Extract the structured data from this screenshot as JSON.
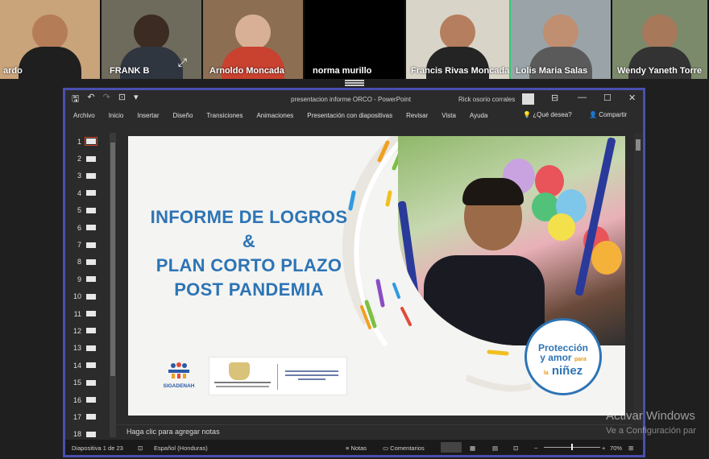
{
  "participants": [
    {
      "name": "ardo"
    },
    {
      "name": "FRANK B"
    },
    {
      "name": "Arnoldo Moncada"
    },
    {
      "name": "norma murillo"
    },
    {
      "name": "Francis Rivas Moncada"
    },
    {
      "name": "Lolis Maria Salas"
    },
    {
      "name": "Wendy Yaneth Torre"
    }
  ],
  "powerpoint": {
    "doc_title": "presentacion informe ORCO  -  PowerPoint",
    "user_name": "Rick osorio corrales",
    "menu": [
      "Archivo",
      "Inicio",
      "Insertar",
      "Diseño",
      "Transiciones",
      "Animaciones",
      "Presentación con diapositivas",
      "Revisar",
      "Vista",
      "Ayuda"
    ],
    "tell_me": "¿Qué desea?",
    "share": "Compartir",
    "slide_numbers": [
      "1",
      "2",
      "3",
      "4",
      "5",
      "6",
      "7",
      "8",
      "9",
      "10",
      "11",
      "12",
      "13",
      "14",
      "15",
      "16",
      "17",
      "18"
    ],
    "notes_placeholder": "Haga clic para agregar notas",
    "status": {
      "slide_counter": "Diapositiva 1 de 23",
      "language": "Español (Honduras)",
      "notes": "Notas",
      "comments": "Comentarios",
      "zoom": "70%"
    }
  },
  "slide": {
    "line1": "INFORME DE LOGROS",
    "line2": "&",
    "line3": "PLAN CORTO PLAZO",
    "line4": "POST PANDEMIA",
    "logo_left": "SIGADENAH",
    "badge_line1": "Protección",
    "badge_line2a": "y amor",
    "badge_line2b": "para",
    "badge_line3": "niñez",
    "badge_line3_prefix": "la"
  },
  "watermark": {
    "line1": "Activar Windows",
    "line2": "Ve a Configuración par"
  }
}
